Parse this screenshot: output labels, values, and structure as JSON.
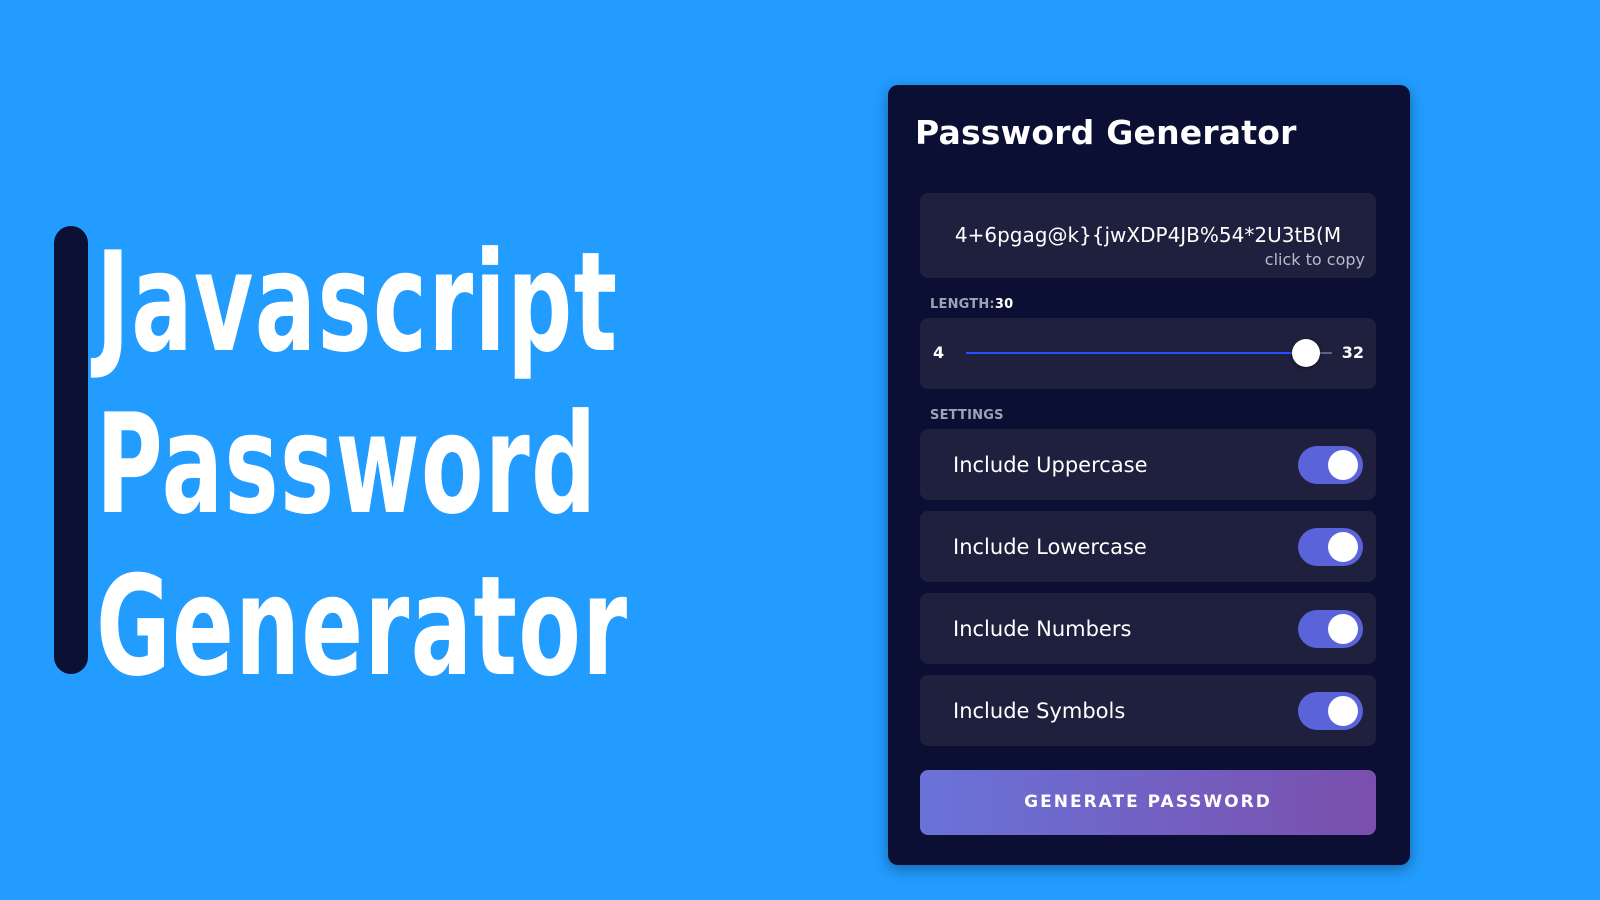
{
  "headline": {
    "lines": [
      "Javascript",
      "Password",
      "Generator"
    ]
  },
  "card": {
    "title": "Password Generator",
    "result": {
      "password": "4+6pgag@k}{jwXDP4JB%54*2U3tB(M",
      "copy_hint": "click to copy"
    },
    "length": {
      "label": "LENGTH:",
      "value": 30,
      "value_text": "30",
      "min": 4,
      "max": 32,
      "min_text": "4",
      "max_text": "32"
    },
    "settings": {
      "label": "SETTINGS",
      "items": [
        {
          "label": "Include Uppercase",
          "enabled": true
        },
        {
          "label": "Include Lowercase",
          "enabled": true
        },
        {
          "label": "Include Numbers",
          "enabled": true
        },
        {
          "label": "Include Symbols",
          "enabled": true
        }
      ]
    },
    "generate_label": "GENERATE PASSWORD"
  },
  "colors": {
    "background": "#229cff",
    "card": "#0b0f33",
    "panel": "#1e203d",
    "toggle_on": "#5a63d9",
    "slider_fill": "#2a4bff"
  }
}
